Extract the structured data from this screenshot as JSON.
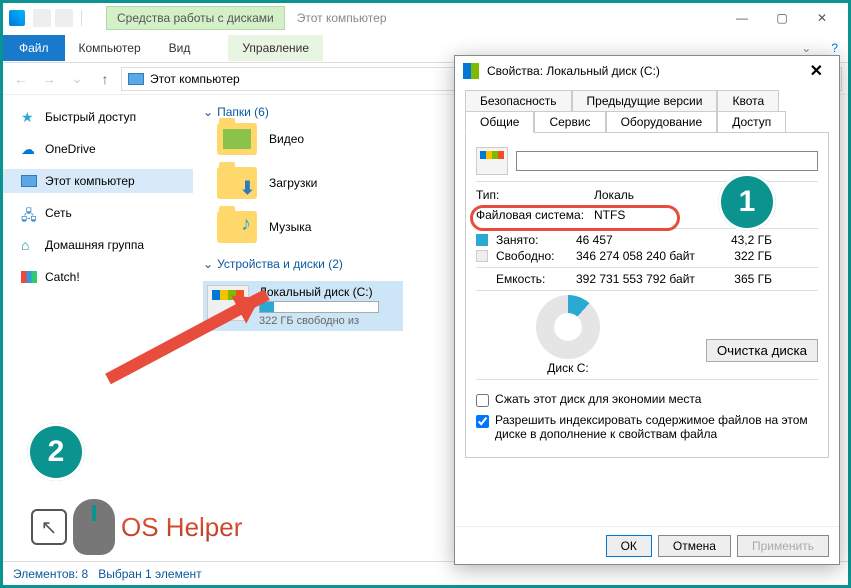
{
  "titlebar": {
    "context_tab": "Средства работы с дисками",
    "window_title": "Этот компьютер"
  },
  "ribbon": {
    "file": "Файл",
    "tabs": [
      "Компьютер",
      "Вид"
    ],
    "context": "Управление"
  },
  "nav": {
    "back": "←",
    "forward": "→",
    "up": "↑",
    "breadcrumb": "Этот компьютер"
  },
  "sidebar": {
    "items": [
      {
        "label": "Быстрый доступ"
      },
      {
        "label": "OneDrive"
      },
      {
        "label": "Этот компьютер"
      },
      {
        "label": "Сеть"
      },
      {
        "label": "Домашняя группа"
      },
      {
        "label": "Catch!"
      }
    ]
  },
  "main": {
    "group_folders": "Папки (6)",
    "folders": [
      {
        "label": "Видео"
      },
      {
        "label": "Загрузки"
      },
      {
        "label": "Музыка"
      }
    ],
    "group_devices": "Устройства и диски (2)",
    "drive": {
      "name": "Локальный диск (C:)",
      "free_line": "322 ГБ свободно из"
    }
  },
  "statusbar": {
    "elements": "Элементов: 8",
    "selected": "Выбран 1 элемент"
  },
  "dialog": {
    "title": "Свойства: Локальный диск (C:)",
    "tabs_row1": [
      "Безопасность",
      "Предыдущие версии",
      "Квота"
    ],
    "tabs_row2": [
      "Общие",
      "Сервис",
      "Оборудование",
      "Доступ"
    ],
    "type_label": "Тип:",
    "type_value": "Локаль",
    "fs_label": "Файловая система:",
    "fs_value": "NTFS",
    "used_label": "Занято:",
    "used_bytes": "46 457",
    "used_gb": "43,2 ГБ",
    "free_label": "Свободно:",
    "free_bytes": "346 274 058 240 байт",
    "free_gb": "322 ГБ",
    "cap_label": "Емкость:",
    "cap_bytes": "392 731 553 792 байт",
    "cap_gb": "365 ГБ",
    "pie_label": "Диск C:",
    "cleanup": "Очистка диска",
    "chk1": "Сжать этот диск для экономии места",
    "chk2": "Разрешить индексировать содержимое файлов на этом диске в дополнение к свойствам файла",
    "ok": "ОК",
    "cancel": "Отмена",
    "apply": "Применить"
  },
  "annotations": {
    "badge1": "1",
    "badge2": "2",
    "logo": "OS Helper",
    "byt": "байт"
  }
}
